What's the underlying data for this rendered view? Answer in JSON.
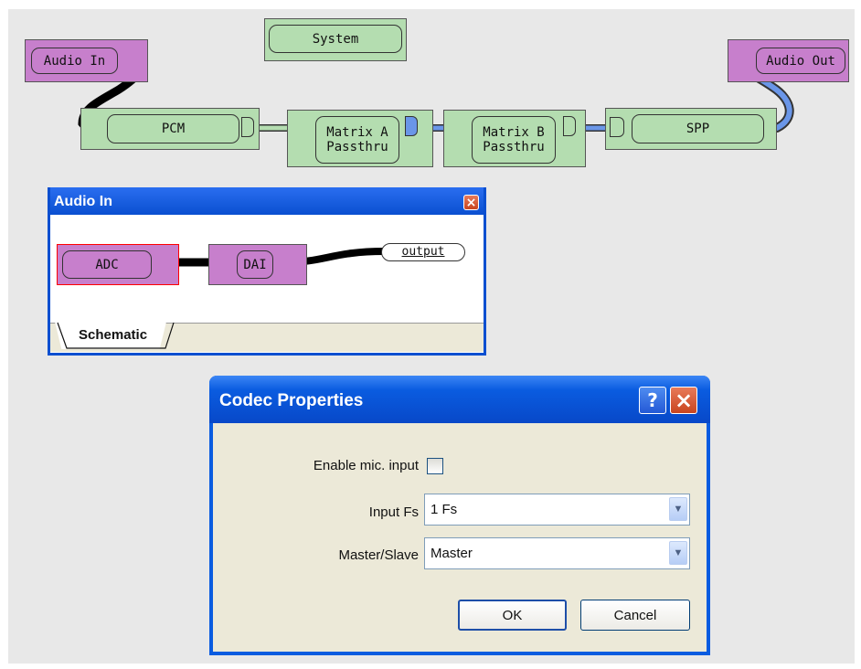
{
  "schematic": {
    "blocks": {
      "audio_in": "Audio In",
      "system": "System",
      "audio_out": "Audio Out",
      "pcm": "PCM",
      "matrix_a_line1": "Matrix A",
      "matrix_a_line2": "Passthru",
      "matrix_b_line1": "Matrix B",
      "matrix_b_line2": "Passthru",
      "spp": "SPP"
    }
  },
  "audio_in_window": {
    "title": "Audio In",
    "close_glyph": "×",
    "blocks": {
      "adc": "ADC",
      "dai": "DAI",
      "output": "output"
    },
    "tab": "Schematic"
  },
  "codec_dialog": {
    "title": "Codec Properties",
    "help_glyph": "?",
    "close_glyph": "×",
    "enable_mic_label": "Enable mic. input",
    "enable_mic_checked": false,
    "input_fs_label": "Input Fs",
    "input_fs_value": "1 Fs",
    "master_slave_label": "Master/Slave",
    "master_slave_value": "Master",
    "ok_label": "OK",
    "cancel_label": "Cancel"
  },
  "colors": {
    "purple_block": "#c77fcc",
    "green_block": "#b4ddb0",
    "xp_title_blue": "#0a5ce0",
    "blue_wire": "#6a96e8"
  }
}
